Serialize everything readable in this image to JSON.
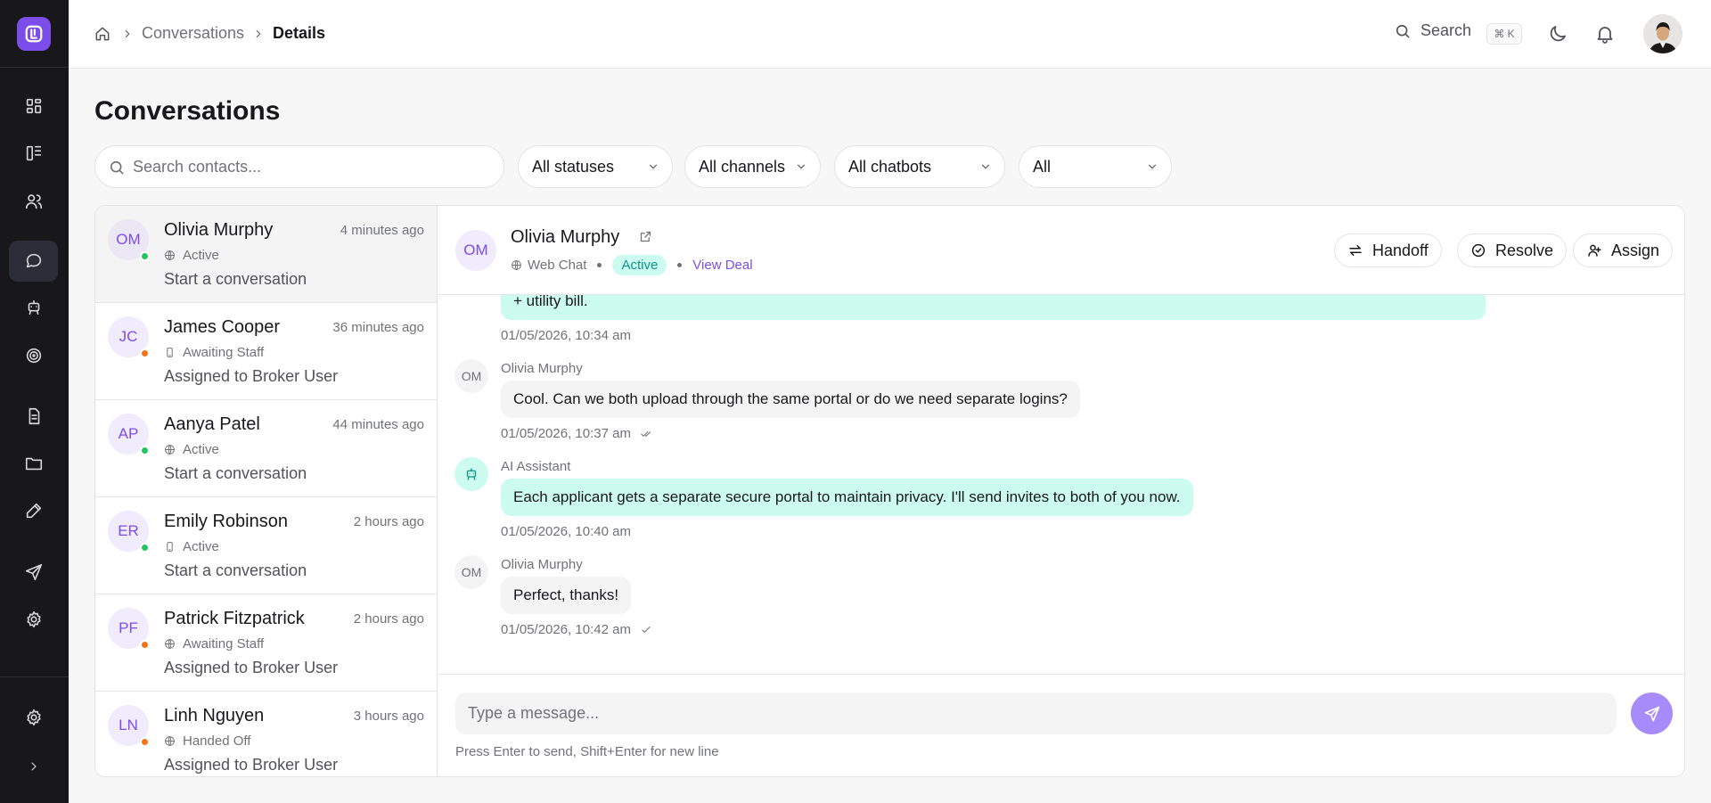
{
  "breadcrumb": {
    "parent": "Conversations",
    "current": "Details"
  },
  "topbar": {
    "search_label": "Search",
    "shortcut": "⌘ K"
  },
  "page": {
    "title": "Conversations"
  },
  "filters": {
    "search_placeholder": "Search contacts...",
    "status": "All statuses",
    "channels": "All channels",
    "chatbots": "All chatbots",
    "assignee": "All"
  },
  "conversations": [
    {
      "initials": "OM",
      "name": "Olivia Murphy",
      "time": "4 minutes ago",
      "channel_icon": "globe-icon",
      "status": "Active",
      "status_color": "#22c55e",
      "preview": "Start a conversation"
    },
    {
      "initials": "JC",
      "name": "James Cooper",
      "time": "36 minutes ago",
      "channel_icon": "phone-icon",
      "status": "Awaiting Staff",
      "status_color": "#f97316",
      "preview": "Assigned to Broker User"
    },
    {
      "initials": "AP",
      "name": "Aanya Patel",
      "time": "44 minutes ago",
      "channel_icon": "globe-icon",
      "status": "Active",
      "status_color": "#22c55e",
      "preview": "Start a conversation"
    },
    {
      "initials": "ER",
      "name": "Emily Robinson",
      "time": "2 hours ago",
      "channel_icon": "phone-icon",
      "status": "Active",
      "status_color": "#22c55e",
      "preview": "Start a conversation"
    },
    {
      "initials": "PF",
      "name": "Patrick Fitzpatrick",
      "time": "2 hours ago",
      "channel_icon": "globe-icon",
      "status": "Awaiting Staff",
      "status_color": "#f97316",
      "preview": "Assigned to Broker User"
    },
    {
      "initials": "LN",
      "name": "Linh Nguyen",
      "time": "3 hours ago",
      "channel_icon": "globe-icon",
      "status": "Handed Off",
      "status_color": "#f97316",
      "preview": "Assigned to Broker User"
    }
  ],
  "chat": {
    "contact_initials": "OM",
    "contact_name": "Olivia Murphy",
    "channel": "Web Chat",
    "status": "Active",
    "view_deal": "View Deal",
    "actions": {
      "handoff": "Handoff",
      "resolve": "Resolve",
      "assign": "Assign"
    },
    "messages": [
      {
        "text": "+ utility bill.",
        "time": "01/05/2026, 10:34 am"
      },
      {
        "sender": "Olivia Murphy",
        "avatar": "OM",
        "text": "Cool. Can we both upload through the same portal or do we need separate logins?",
        "time": "01/05/2026, 10:37 am"
      },
      {
        "sender": "AI Assistant",
        "text": "Each applicant gets a separate secure portal to maintain privacy. I'll send invites to both of you now.",
        "time": "01/05/2026, 10:40 am"
      },
      {
        "sender": "Olivia Murphy",
        "avatar": "OM",
        "text": "Perfect, thanks!",
        "time": "01/05/2026, 10:42 am"
      }
    ],
    "composer_placeholder": "Type a message...",
    "hint": "Press Enter to send, Shift+Enter for new line"
  },
  "colors": {
    "accent": "#7c4de8",
    "ai_bubble": "#ccfbef",
    "sidebar_bg": "#18181b"
  }
}
